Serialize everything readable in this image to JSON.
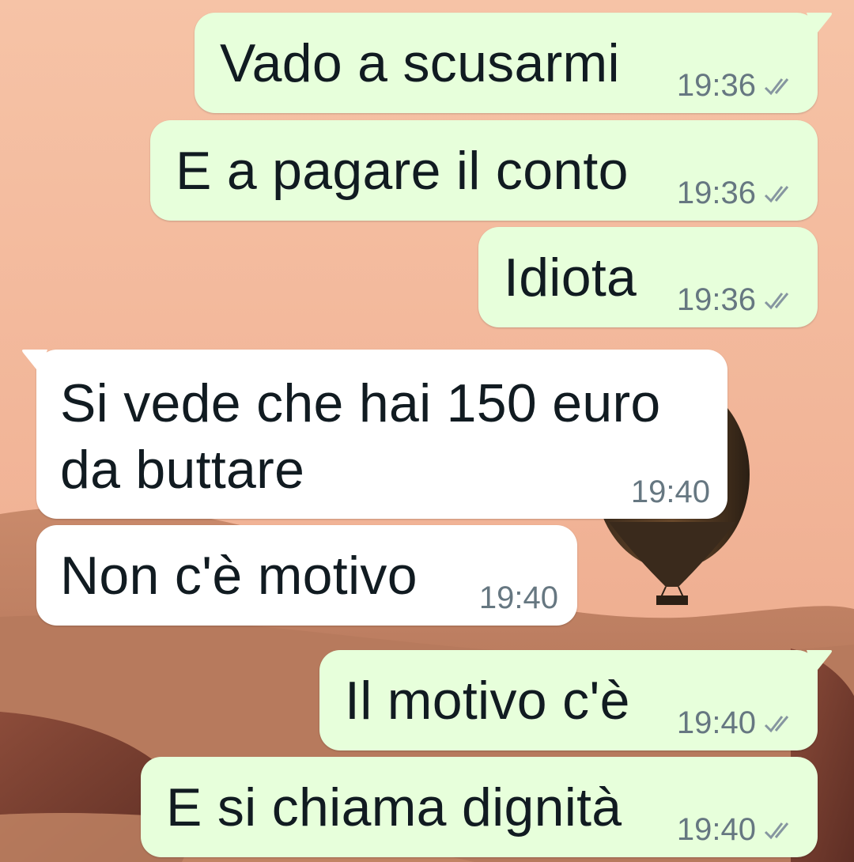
{
  "messages": [
    {
      "direction": "outgoing",
      "text": "Vado a scusarmi",
      "time": "19:36",
      "status_icon": "double-check-icon",
      "first_in_group": true
    },
    {
      "direction": "outgoing",
      "text": "E a pagare il conto",
      "time": "19:36",
      "status_icon": "double-check-icon",
      "first_in_group": false
    },
    {
      "direction": "outgoing",
      "text": "Idiota",
      "time": "19:36",
      "status_icon": "double-check-icon",
      "first_in_group": false
    },
    {
      "direction": "incoming",
      "text": "Si vede che hai 150 euro\nda buttare",
      "time": "19:40",
      "first_in_group": true
    },
    {
      "direction": "incoming",
      "text": "Non c'è motivo",
      "time": "19:40",
      "first_in_group": false
    },
    {
      "direction": "outgoing",
      "text": "Il motivo c'è",
      "time": "19:40",
      "status_icon": "double-check-icon",
      "first_in_group": true
    },
    {
      "direction": "outgoing",
      "text": "E si chiama dignità",
      "time": "19:40",
      "status_icon": "double-check-icon",
      "first_in_group": false
    }
  ],
  "colors": {
    "outgoing_bubble": "#e7ffdb",
    "incoming_bubble": "#ffffff",
    "message_text": "#111b21",
    "meta_text": "#667781",
    "wallpaper_sky": "#f3b89a",
    "wallpaper_dunes": "#b87a5e"
  },
  "wallpaper": {
    "description_icon": "desert-hot-air-balloon-wallpaper"
  }
}
